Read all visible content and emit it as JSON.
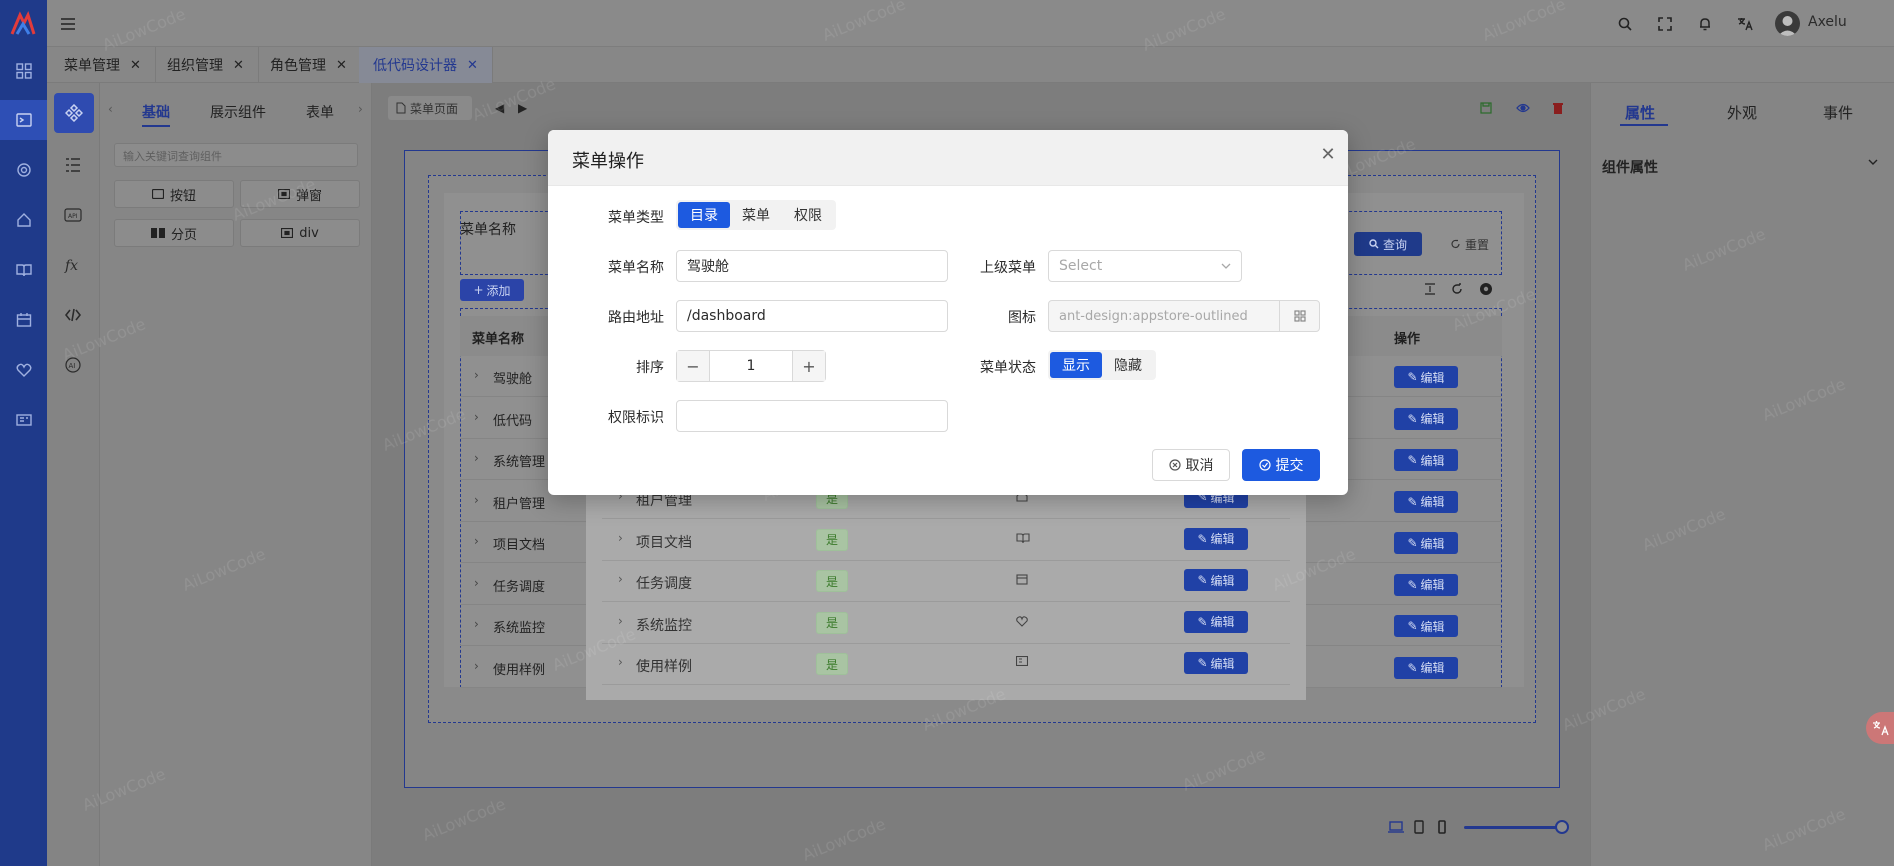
{
  "header": {
    "username": "Axelu"
  },
  "tabs": [
    {
      "label": "菜单管理"
    },
    {
      "label": "组织管理"
    },
    {
      "label": "角色管理"
    },
    {
      "label": "低代码设计器",
      "active": true
    }
  ],
  "component_panel": {
    "tabs": [
      "基础",
      "展示组件",
      "表单"
    ],
    "search_placeholder": "输入关键词查询组件",
    "items": [
      "按钮",
      "弹窗",
      "分页",
      "div"
    ]
  },
  "canvas": {
    "page_label": "菜单页面",
    "form_label": "菜单名称",
    "query_button": "查询",
    "reset_button": "重置",
    "add_button": "添加",
    "table_header_name": "菜单名称",
    "table_header_action": "操作",
    "rows": [
      "驾驶舱",
      "低代码",
      "系统管理",
      "租户管理",
      "项目文档",
      "任务调度",
      "系统监控",
      "使用样例"
    ],
    "edit_label": "编辑"
  },
  "canvas_inner_table": {
    "rows": [
      {
        "name": "租户管理",
        "visible": "是"
      },
      {
        "name": "项目文档",
        "visible": "是"
      },
      {
        "name": "任务调度",
        "visible": "是"
      },
      {
        "name": "系统监控",
        "visible": "是"
      },
      {
        "name": "使用样例",
        "visible": "是"
      }
    ],
    "edit_label": "编辑"
  },
  "right_panel": {
    "tabs": [
      "属性",
      "外观",
      "事件"
    ],
    "section": "组件属性"
  },
  "watermark": "AiLowCode",
  "modal": {
    "title": "菜单操作",
    "menu_type_label": "菜单类型",
    "menu_type_options": [
      "目录",
      "菜单",
      "权限"
    ],
    "menu_type_selected": "目录",
    "menu_name_label": "菜单名称",
    "menu_name_value": "驾驶舱",
    "parent_label": "上级菜单",
    "parent_placeholder": "Select",
    "route_label": "路由地址",
    "route_value": "/dashboard",
    "icon_label": "图标",
    "icon_value": "ant-design:appstore-outlined",
    "sort_label": "排序",
    "sort_value": "1",
    "status_label": "菜单状态",
    "status_options": [
      "显示",
      "隐藏"
    ],
    "status_selected": "显示",
    "perm_label": "权限标识",
    "perm_value": "",
    "cancel_label": "取消",
    "submit_label": "提交"
  },
  "colors": {
    "primary": "#1d5ae0",
    "rail": "#1f3a8a"
  }
}
